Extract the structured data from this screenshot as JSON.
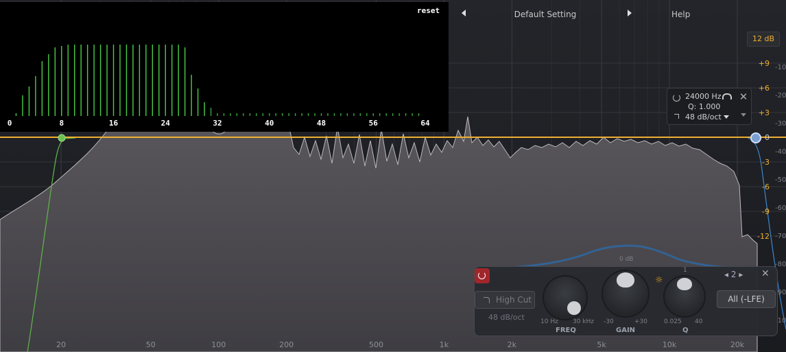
{
  "header": {
    "preset_name": "Default Setting",
    "help_label": "Help",
    "range_label": "12 dB"
  },
  "spectrum_overlay": {
    "reset_label": "reset",
    "x_ticks": [
      "0",
      "8",
      "16",
      "24",
      "32",
      "40",
      "48",
      "56",
      "64"
    ]
  },
  "axes": {
    "freq_ticks": [
      {
        "label": "20",
        "hz": 20
      },
      {
        "label": "50",
        "hz": 50
      },
      {
        "label": "100",
        "hz": 100
      },
      {
        "label": "200",
        "hz": 200
      },
      {
        "label": "500",
        "hz": 500
      },
      {
        "label": "1k",
        "hz": 1000
      },
      {
        "label": "2k",
        "hz": 2000
      },
      {
        "label": "5k",
        "hz": 5000
      },
      {
        "label": "10k",
        "hz": 10000
      },
      {
        "label": "20k",
        "hz": 20000
      }
    ],
    "gain_ticks": [
      {
        "label": "+9",
        "db": 9
      },
      {
        "label": "+6",
        "db": 6
      },
      {
        "label": "+3",
        "db": 3
      },
      {
        "label": "0",
        "db": 0
      },
      {
        "label": "-3",
        "db": -3
      },
      {
        "label": "-6",
        "db": -6
      },
      {
        "label": "-9",
        "db": -9
      },
      {
        "label": "-12",
        "db": -12
      }
    ],
    "analyzer_ticks": [
      "0",
      "-10",
      "-20",
      "-30",
      "-40",
      "-50",
      "-60",
      "-70",
      "-80",
      "-90",
      "-100"
    ]
  },
  "band_popup": {
    "frequency": "24000 Hz",
    "q": "Q: 1.000",
    "slope": "48 dB/oct"
  },
  "band_panel": {
    "shape_label": "High Cut",
    "slope_label": "48 dB/oct",
    "gain_top": "0 dB",
    "q_top": "1",
    "freq_min": "10 Hz",
    "freq_max": "30 kHz",
    "gain_min": "-30",
    "gain_max": "+30",
    "q_min": "0.025",
    "q_max": "40",
    "freq_label": "FREQ",
    "gain_label": "GAIN",
    "q_label": "Q",
    "band_number": "2",
    "output_label": "All (-LFE)"
  },
  "colors": {
    "accent": "#f0b030",
    "band1": "#5fb04a",
    "band2": "#3a7fc4",
    "power_active": "#a0262b"
  }
}
